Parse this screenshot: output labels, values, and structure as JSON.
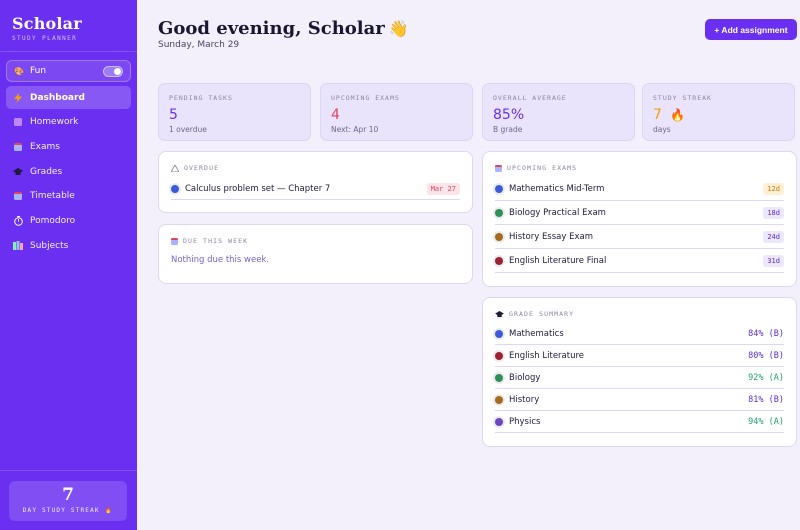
{
  "sidebar": {
    "brand": "Scholar",
    "brand_sub": "STUDY PLANNER",
    "mode": {
      "label": "Fun",
      "on": true
    },
    "nav": [
      {
        "key": "dashboard",
        "label": "Dashboard",
        "active": true,
        "icon": "bolt-icon",
        "color": "#f59e0b"
      },
      {
        "key": "homework",
        "label": "Homework",
        "active": false,
        "icon": "book-icon",
        "color": "#c084fc"
      },
      {
        "key": "exams",
        "label": "Exams",
        "active": false,
        "icon": "calendar-icon",
        "color": "#a5b4fc"
      },
      {
        "key": "grades",
        "label": "Grades",
        "active": false,
        "icon": "grad-cap-icon",
        "color": "#1f1b3a"
      },
      {
        "key": "timetable",
        "label": "Timetable",
        "active": false,
        "icon": "calendar-icon",
        "color": "#a5b4fc"
      },
      {
        "key": "pomodoro",
        "label": "Pomodoro",
        "active": false,
        "icon": "timer-icon",
        "color": "#ffffff"
      },
      {
        "key": "subjects",
        "label": "Subjects",
        "active": false,
        "icon": "books-icon",
        "color": "#86efac"
      }
    ],
    "streak": {
      "value": "7",
      "label": "DAY STUDY STREAK",
      "icon": "fire-icon"
    }
  },
  "header": {
    "greeting": "Good evening, Scholar",
    "wave_icon": "wave-hand-icon",
    "date": "Sunday, March 29",
    "add_button": "+ Add assignment"
  },
  "stats": [
    {
      "label": "PENDING TASKS",
      "value": "5",
      "sub": "1 overdue",
      "color": "#6a2ff0"
    },
    {
      "label": "UPCOMING EXAMS",
      "value": "4",
      "sub": "Next: Apr 10",
      "color": "#e0455f"
    },
    {
      "label": "OVERALL AVERAGE",
      "value": "85%",
      "sub": "B grade",
      "color": "#6a2ff0"
    },
    {
      "label": "STUDY STREAK",
      "value": "7",
      "sub": "days",
      "color": "#f59e0b",
      "icon": "fire-icon"
    }
  ],
  "overdue": {
    "title": "OVERDUE",
    "items": [
      {
        "name": "Calculus problem set — Chapter 7",
        "date": "Mar 27",
        "dot": "#3b5bdb"
      }
    ]
  },
  "due_week": {
    "title": "DUE THIS WEEK",
    "empty": "Nothing due this week."
  },
  "upcoming_exams": {
    "title": "UPCOMING EXAMS",
    "items": [
      {
        "name": "Mathematics Mid-Term",
        "days": "12d",
        "dot": "#3b5bdb",
        "badge_bg": "#fdf0d5",
        "badge_fg": "#d97706"
      },
      {
        "name": "Biology Practical Exam",
        "days": "18d",
        "dot": "#2f8f5b",
        "badge_bg": "#ede7fb",
        "badge_fg": "#5b2bd6"
      },
      {
        "name": "History Essay Exam",
        "days": "24d",
        "dot": "#a56a1f",
        "badge_bg": "#ede7fb",
        "badge_fg": "#5b2bd6"
      },
      {
        "name": "English Literature Final",
        "days": "31d",
        "dot": "#9b2335",
        "badge_bg": "#ede7fb",
        "badge_fg": "#5b2bd6"
      }
    ]
  },
  "grade_summary": {
    "title": "GRADE SUMMARY",
    "items": [
      {
        "name": "Mathematics",
        "grade": "84% (B)",
        "dot": "#3b5bdb",
        "color": "#5b2bd6"
      },
      {
        "name": "English Literature",
        "grade": "80% (B)",
        "dot": "#9b2335",
        "color": "#5b2bd6"
      },
      {
        "name": "Biology",
        "grade": "92% (A)",
        "dot": "#2f8f5b",
        "color": "#22a06b"
      },
      {
        "name": "History",
        "grade": "81% (B)",
        "dot": "#a56a1f",
        "color": "#5b2bd6"
      },
      {
        "name": "Physics",
        "grade": "94% (A)",
        "dot": "#6b46c1",
        "color": "#22a06b"
      }
    ]
  }
}
